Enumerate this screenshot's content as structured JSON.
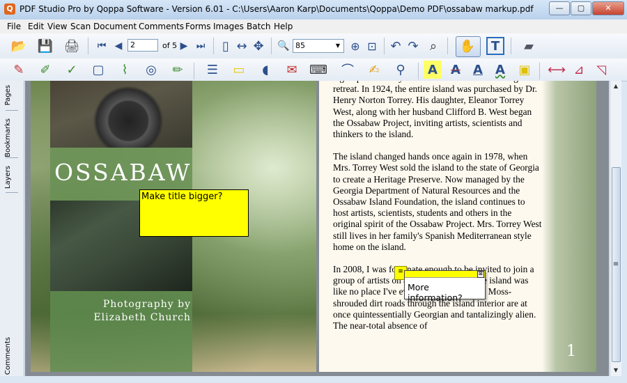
{
  "window": {
    "title": "PDF Studio Pro by Qoppa Software - Version 6.01 - C:\\Users\\Aaron Karp\\Documents\\Qoppa\\Demo PDF\\ossabaw markup.pdf",
    "app_icon_glyph": "Q",
    "minimize": "—",
    "maximize": "▢",
    "close": "✕"
  },
  "menu": [
    "File",
    "Edit",
    "View",
    "Scan",
    "Document",
    "Comments",
    "Forms",
    "Images",
    "Batch",
    "Help"
  ],
  "toolbar": {
    "page_current": "2",
    "page_total_label": "of 5",
    "zoom": "85",
    "zoom_arrow": "▼",
    "icons": {
      "open": "📂",
      "save": "💾",
      "print": "🖨",
      "first": "⏮",
      "prev": "◀",
      "next": "▶",
      "last": "⏭",
      "fit_page": "▯",
      "fit_width": "↔",
      "fit_all": "✥",
      "zoom_tool": "🔍",
      "zoom_in": "⊕",
      "zoom_marquee": "⊡",
      "rotate_ccw": "↶",
      "rotate_cw": "↷",
      "find": "⌕",
      "hand": "✋",
      "text_select": "T",
      "scanner": "▰"
    }
  },
  "annot_toolbar": {
    "icons": [
      "✎",
      "✐",
      "✓",
      "▢",
      "⌇",
      "◎",
      "✏",
      "☰",
      "▭",
      "◖",
      "✉",
      "⌨",
      "⌒",
      "✍",
      "⚲",
      "A",
      "A",
      "A",
      "A",
      "▣",
      "⟷",
      "⊿",
      "◹"
    ]
  },
  "side_tabs": [
    "Pages",
    "Bookmarks",
    "Layers",
    "Comments"
  ],
  "left_page": {
    "title": "OSSABAW",
    "credit_line1": "Photography by",
    "credit_line2": "Elizabeth Church",
    "sticky_note": "Make title bigger?"
  },
  "right_page": {
    "paragraphs": [
      "a group of wealthy Detroiters for use as a hunting retreat. In 1924, the entire island was purchased by Dr. Henry Norton Torrey. His daughter, Eleanor Torrey West, along with her husband Clifford B. West began the Ossabaw Project, inviting artists, scientists and thinkers to the island.",
      "The island changed hands once again in 1978, when Mrs. Torrey West sold the island to the state of Georgia to create a Heritage Preserve. Now managed by the Georgia Department of Natural Resources and the Ossabaw Island Foundation, the island continues to host artists, scientists, students and others in the original spirit of the Ossabaw Project. Mrs. Torrey West still lives in her family's Spanish Mediterranean style home on the island.",
      "In 2008, I was fortunate enough to be invited to join a group of artists on a trip to Ossabaw. The island was like no place I've ever been. The Spanish Moss-shrouded dirt roads through the island interior are at once quintessentially Georgian and tantalizingly alien. The near-total absence of"
    ],
    "page_number": "1",
    "popup_note": "More information?",
    "popup_close": "⊠",
    "note_icon": "≡"
  },
  "scrollbar": {
    "up": "▲",
    "down": "▼",
    "grip": "≡"
  }
}
